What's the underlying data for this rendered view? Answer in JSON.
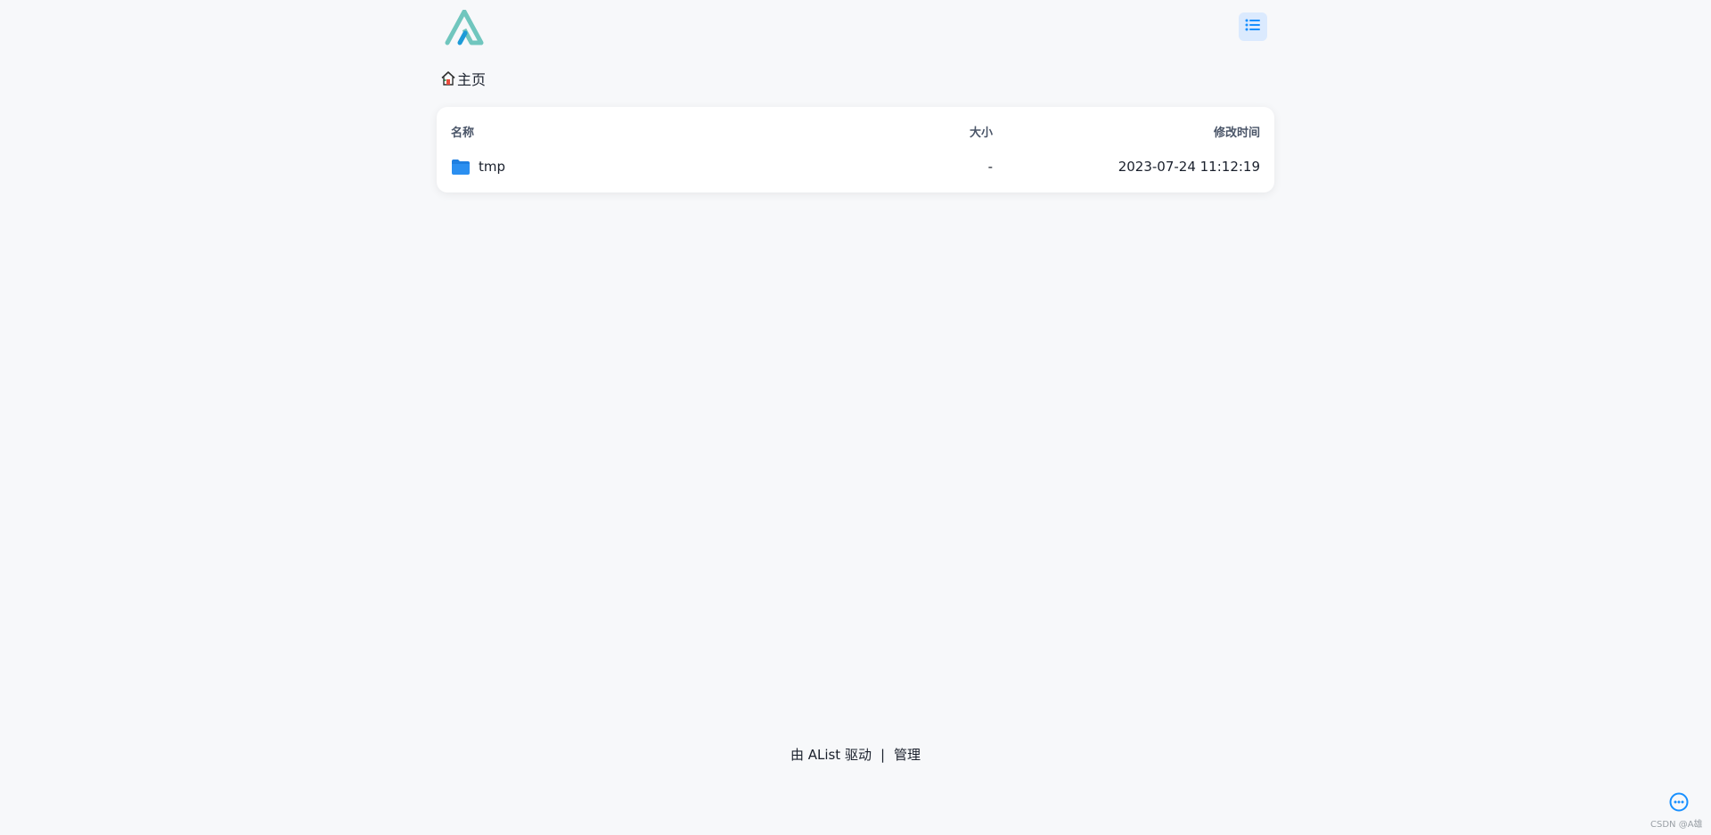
{
  "header": {
    "logo_icon": "alist-logo-icon",
    "layout_toggle_icon": "list-icon",
    "accent_color": "#1890ff"
  },
  "breadcrumb": {
    "home_icon": "home-icon",
    "home_label": "主页"
  },
  "table": {
    "columns": {
      "name": "名称",
      "size": "大小",
      "modified": "修改时间"
    },
    "rows": [
      {
        "icon": "folder-icon",
        "name": "tmp",
        "size": "-",
        "modified": "2023-07-24 11:12:19"
      }
    ]
  },
  "footer": {
    "powered_by": "由 AList 驱动",
    "separator": "|",
    "manage_link": "管理"
  },
  "floating": {
    "more_icon": "more-icon"
  },
  "watermark": "CSDN @A雄"
}
